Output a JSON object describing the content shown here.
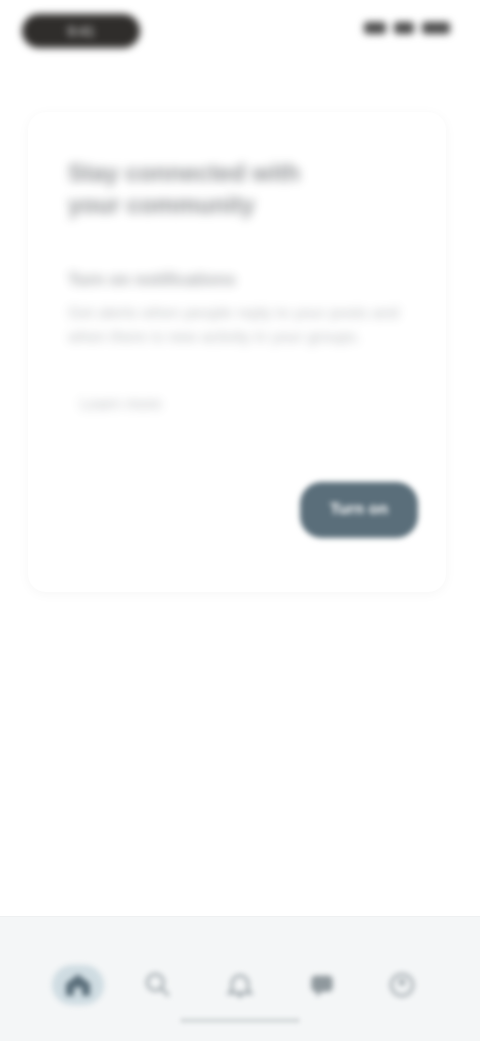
{
  "status_bar": {
    "time": "9:41"
  },
  "card": {
    "title": "Stay connected with your community",
    "subtitle": "Turn on notifications",
    "body": "Get alerts when people reply to your posts and when there is new activity in your groups.",
    "link": "Learn more",
    "button_label": "Turn on"
  },
  "bottom_nav": {
    "items": [
      {
        "icon": "home-icon",
        "active": true
      },
      {
        "icon": "search-icon",
        "active": false
      },
      {
        "icon": "bell-icon",
        "active": false
      },
      {
        "icon": "chat-icon",
        "active": false
      },
      {
        "icon": "profile-icon",
        "active": false
      }
    ]
  },
  "colors": {
    "primary": "#5a6e7a",
    "nav_background": "#f4f6f7",
    "nav_indicator": "#cfdce2",
    "status_pill": "#2f2d2b"
  }
}
